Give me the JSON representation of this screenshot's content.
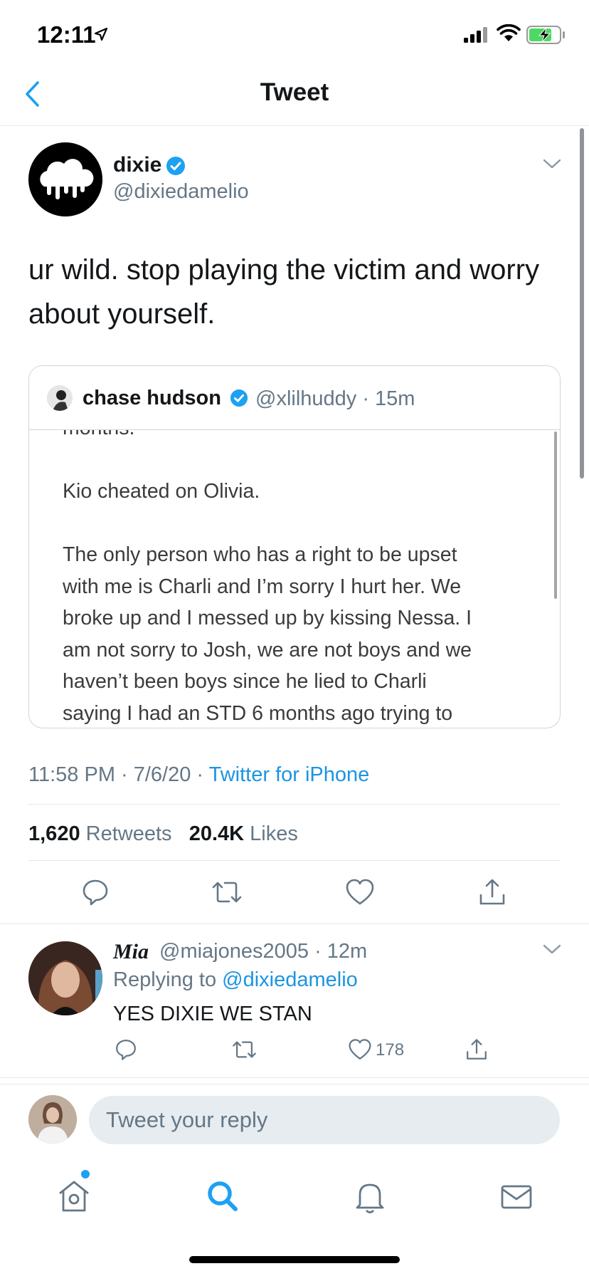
{
  "status_bar": {
    "time": "12:11"
  },
  "header": {
    "title": "Tweet"
  },
  "tweet": {
    "author_name": "dixie",
    "author_handle": "@dixiedamelio",
    "text": "ur wild. stop playing the victim and worry about yourself.",
    "timestamp": "11:58 PM · 7/6/20 · ",
    "source": "Twitter for iPhone",
    "retweets_count": "1,620",
    "retweets_label": " Retweets",
    "likes_count": "20.4K",
    "likes_label": " Likes"
  },
  "quoted_tweet": {
    "author_name": "chase hudson",
    "author_handle": "@xlilhuddy · 15m",
    "lines": [
      "months.",
      "",
      "Kio cheated on Olivia.",
      "",
      "The only person who has a right to be upset",
      "with me is Charli and I’m sorry I hurt her. We",
      "broke up and I messed up by kissing Nessa. I",
      "am not sorry to Josh, we are not boys and we",
      "haven’t been boys since he lied to Charli",
      "saying I had an STD 6 months ago trying to"
    ]
  },
  "reply": {
    "author_name": "Mia",
    "author_handle": "@miajones2005 · 12m",
    "replying_prefix": "Replying to ",
    "replying_to": "@dixiedamelio",
    "text": "YES DIXIE WE STAN",
    "like_count": "178"
  },
  "composer": {
    "placeholder": "Tweet your reply"
  },
  "icons": {
    "status": [
      "location-arrow-icon",
      "signal-icon",
      "wifi-icon",
      "battery-charging-icon"
    ],
    "actions": [
      "reply-icon",
      "retweet-icon",
      "like-icon",
      "share-icon"
    ],
    "tabs": [
      "home-icon",
      "search-icon",
      "notifications-icon",
      "messages-icon"
    ]
  },
  "colors": {
    "accent": "#1da1f2",
    "link": "#1b95e0",
    "secondary_text": "#657786",
    "divider": "#e1e8ed",
    "battery": "#4cd964"
  }
}
